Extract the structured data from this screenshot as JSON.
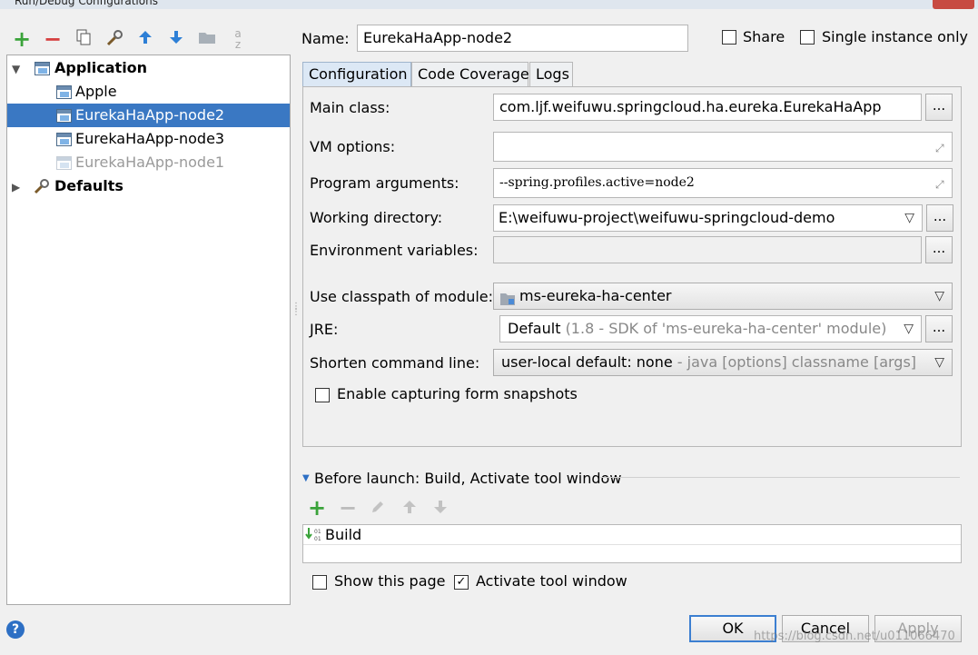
{
  "window": {
    "title": "Run/Debug Configurations"
  },
  "toolbar": {
    "icons": [
      "add-icon",
      "remove-icon",
      "copy-icon",
      "edit-defaults-icon",
      "move-up-icon",
      "move-down-icon",
      "folder-icon",
      "sort-icon"
    ]
  },
  "tree": {
    "root": "Application",
    "items": [
      {
        "label": "Apple",
        "state": "normal"
      },
      {
        "label": "EurekaHaApp-node2",
        "state": "selected"
      },
      {
        "label": "EurekaHaApp-node3",
        "state": "normal"
      },
      {
        "label": "EurekaHaApp-node1",
        "state": "disabled"
      }
    ],
    "defaults": "Defaults"
  },
  "header": {
    "name_label": "Name:",
    "name_value": "EurekaHaApp-node2",
    "share_label": "Share",
    "single_instance_label": "Single instance only"
  },
  "tabs": [
    "Configuration",
    "Code Coverage",
    "Logs"
  ],
  "config": {
    "main_class_label": "Main class:",
    "main_class_value": "com.ljf.weifuwu.springcloud.ha.eureka.EurekaHaApp",
    "vm_options_label": "VM options:",
    "vm_options_value": "",
    "program_args_label": "Program arguments:",
    "program_args_value": "--spring.profiles.active=node2",
    "working_dir_label": "Working directory:",
    "working_dir_value": "E:\\weifuwu-project\\weifuwu-springcloud-demo",
    "env_vars_label": "Environment variables:",
    "env_vars_value": "",
    "classpath_label": "Use classpath of module:",
    "classpath_value": "ms-eureka-ha-center",
    "jre_label": "JRE:",
    "jre_value": "Default",
    "jre_hint": "(1.8 - SDK of 'ms-eureka-ha-center' module)",
    "shorten_label": "Shorten command line:",
    "shorten_value": "user-local default: none",
    "shorten_hint": "- java [options] classname [args]",
    "snapshots_label": "Enable capturing form snapshots",
    "dots": "..."
  },
  "before_launch": {
    "title": "Before launch: Build, Activate tool window",
    "items": [
      "Build"
    ]
  },
  "footer": {
    "show_page_label": "Show this page",
    "activate_label": "Activate tool window",
    "ok": "OK",
    "cancel": "Cancel",
    "apply": "Apply",
    "help": "?",
    "watermark": "https://blog.csdn.net/u011066470"
  },
  "colors": {
    "selection": "#3a78c3",
    "accent_green": "#3aa33a",
    "accent_red": "#d64040",
    "accent_blue": "#3c7fd1"
  }
}
